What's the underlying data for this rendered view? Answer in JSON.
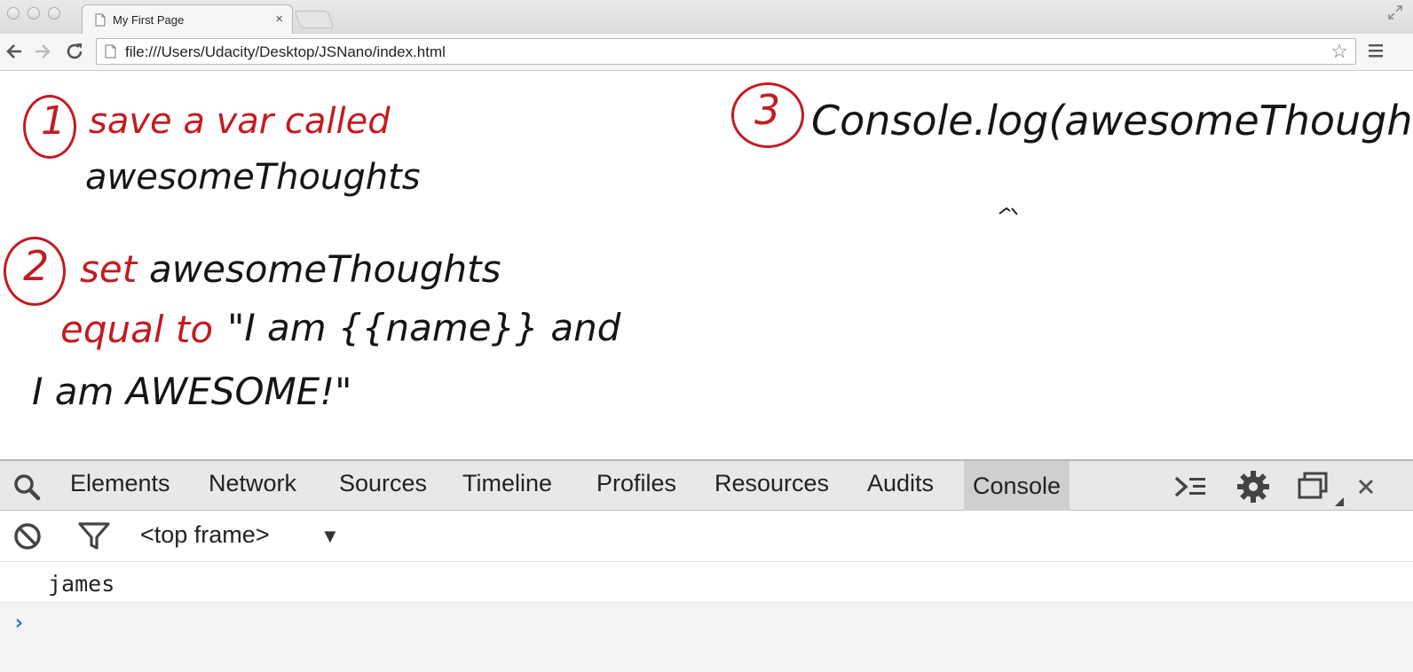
{
  "browser": {
    "tab_title": "My First Page",
    "tab_close": "×",
    "url": "file:///Users/Udacity/Desktop/JSNano/index.html",
    "star": "☆"
  },
  "page": {
    "step1": {
      "number": "1",
      "line1": "save a var called",
      "line2": "awesomeThoughts"
    },
    "step2": {
      "number": "2",
      "line1_red": "set",
      "line1_black": "awesomeThoughts",
      "line2_red": "equal to",
      "line2_black": "\"I am {{name}} and",
      "line3": "I am AWESOME!\""
    },
    "step3": {
      "number": "3",
      "text": "Console.log(awesomeThoughts)"
    }
  },
  "devtools": {
    "tabs": [
      "Elements",
      "Network",
      "Sources",
      "Timeline",
      "Profiles",
      "Resources",
      "Audits",
      "Console"
    ],
    "active_tab": "Console",
    "frame_selector": "<top frame>",
    "frame_arrow": "▼",
    "close": "✕",
    "console_output": [
      "james"
    ],
    "prompt": "›"
  },
  "colors": {
    "ink_red": "#c31b22",
    "ink_black": "#151515",
    "prompt_blue": "#2f6fd6"
  },
  "icons": [
    "document-icon",
    "back-arrow-icon",
    "forward-arrow-icon",
    "reload-icon",
    "star-icon",
    "menu-icon",
    "search-icon",
    "drawer-toggle-icon",
    "gear-icon",
    "dock-icon",
    "close-icon",
    "clear-icon",
    "filter-icon"
  ]
}
